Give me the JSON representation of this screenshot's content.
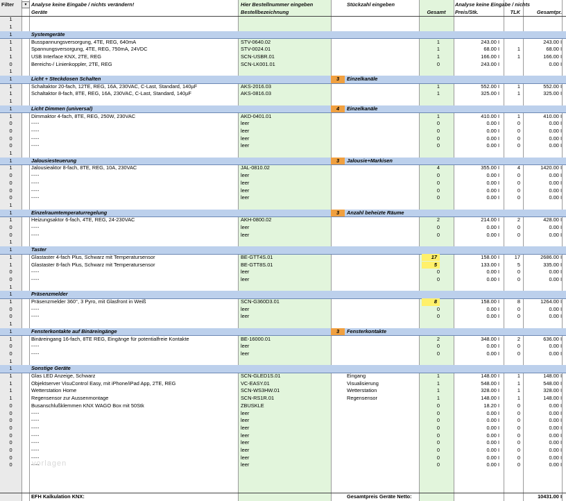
{
  "header": {
    "row1": {
      "filter": "Filter",
      "col_a": "Analyse keine Eingabe / nichts verändern!",
      "col_b": "Hier Bestellnummer eingeben",
      "col_c": "Stückzahl eingeben",
      "col_e": "Analyse keine Eingabe / nichts",
      "col_h": ""
    },
    "row2": {
      "col_a": "Geräte",
      "col_b": "Bestellbezeichnung",
      "col_d": "Gesamt",
      "col_e": "Preis/Stk.",
      "col_g": "TLK",
      "col_h": "Gesamtpr."
    }
  },
  "sections": [
    {
      "title": "Systemgeräte",
      "note_num": "",
      "note_label": "",
      "rows": [
        {
          "f": "1",
          "a": "Busspannungsversorgung, 4TE, REG, 640mA",
          "b": "STV-0640.02",
          "c": "",
          "d": "1",
          "e": "243.00 I",
          "g": "",
          "h": "243.00 I"
        },
        {
          "f": "1",
          "a": "Spannungsversorgung, 4TE, REG, 750mA, 24VDC",
          "b": "STV-0024.01",
          "c": "",
          "d": "1",
          "e": "68.00 I",
          "g": "1",
          "h": "68.00 I"
        },
        {
          "f": "1",
          "a": "USB Interface KNX, 2TE, REG",
          "b": "SCN-USBR.01",
          "c": "",
          "d": "1",
          "e": "166.00 I",
          "g": "1",
          "h": "166.00 I"
        },
        {
          "f": "0",
          "a": "Bereichs-/ Linienkoppler, 2TE, REG",
          "b": "SCN-LK001.01",
          "c": "",
          "d": "0",
          "e": "243.00 I",
          "g": "",
          "h": "0.00 I"
        }
      ]
    },
    {
      "title": "Licht + Steckdosen Schalten",
      "note_num": "3",
      "note_label": "Einzelkanäle",
      "rows": [
        {
          "f": "1",
          "a": "Schaltaktor 20-fach, 12TE, REG, 16A, 230VAC, C-Last, Standard, 140µF",
          "b": "AKS-2016.03",
          "c": "",
          "d": "1",
          "e": "552.00 I",
          "g": "1",
          "h": "552.00 I"
        },
        {
          "f": "1",
          "a": "Schaltaktor 8-fach, 8TE, REG, 16A, 230VAC, C-Last, Standard, 140µF",
          "b": "AKS-0816.03",
          "c": "",
          "d": "1",
          "e": "325.00 I",
          "g": "1",
          "h": "325.00 I"
        }
      ]
    },
    {
      "title": "Licht Dimmen (universal)",
      "note_num": "4",
      "note_label": "Einzelkanäle",
      "rows": [
        {
          "f": "1",
          "a": "Dimmaktor 4-fach, 8TE, REG, 250W, 230VAC",
          "b": "AKD-0401.01",
          "c": "",
          "d": "1",
          "e": "410.00 I",
          "g": "1",
          "h": "410.00 I"
        },
        {
          "f": "0",
          "a": "----",
          "b": "leer",
          "c": "",
          "d": "0",
          "e": "0.00 I",
          "g": "0",
          "h": "0.00 I"
        },
        {
          "f": "0",
          "a": "----",
          "b": "leer",
          "c": "",
          "d": "0",
          "e": "0.00 I",
          "g": "0",
          "h": "0.00 I"
        },
        {
          "f": "0",
          "a": "----",
          "b": "leer",
          "c": "",
          "d": "0",
          "e": "0.00 I",
          "g": "0",
          "h": "0.00 I"
        },
        {
          "f": "0",
          "a": "----",
          "b": "leer",
          "c": "",
          "d": "0",
          "e": "0.00 I",
          "g": "0",
          "h": "0.00 I"
        }
      ]
    },
    {
      "title": "Jalousiesteuerung",
      "note_num": "3",
      "note_label": "Jalousie+Markisen",
      "rows": [
        {
          "f": "1",
          "a": "Jalousieaktor 8-fach, 8TE, REG, 10A, 230VAC",
          "b": "JAL-0810.02",
          "c": "",
          "d": "4",
          "e": "355.00 I",
          "g": "4",
          "h": "1420.00 I"
        },
        {
          "f": "0",
          "a": "----",
          "b": "leer",
          "c": "",
          "d": "0",
          "e": "0.00 I",
          "g": "0",
          "h": "0.00 I"
        },
        {
          "f": "0",
          "a": "----",
          "b": "leer",
          "c": "",
          "d": "0",
          "e": "0.00 I",
          "g": "0",
          "h": "0.00 I"
        },
        {
          "f": "0",
          "a": "----",
          "b": "leer",
          "c": "",
          "d": "0",
          "e": "0.00 I",
          "g": "0",
          "h": "0.00 I"
        },
        {
          "f": "0",
          "a": "----",
          "b": "leer",
          "c": "",
          "d": "0",
          "e": "0.00 I",
          "g": "0",
          "h": "0.00 I"
        }
      ]
    },
    {
      "title": "Einzelraumtemperaturregelung",
      "note_num": "3",
      "note_label": "Anzahl beheizte Räume",
      "rows": [
        {
          "f": "1",
          "a": "Heizungsaktor 6-fach, 4TE, REG, 24-230VAC",
          "b": "AKH-0800.02",
          "c": "",
          "d": "2",
          "e": "214.00 I",
          "g": "2",
          "h": "428.00 I"
        },
        {
          "f": "0",
          "a": "----",
          "b": "leer",
          "c": "",
          "d": "0",
          "e": "0.00 I",
          "g": "0",
          "h": "0.00 I"
        },
        {
          "f": "0",
          "a": "----",
          "b": "leer",
          "c": "",
          "d": "0",
          "e": "0.00 I",
          "g": "0",
          "h": "0.00 I"
        }
      ]
    },
    {
      "title": "Taster",
      "note_num": "",
      "note_label": "",
      "rows": [
        {
          "f": "1",
          "a": "Glastaster 4-fach Plus, Schwarz mit Temperatursensor",
          "b": "BE-GTT4S.01",
          "c": "",
          "d": "17",
          "e": "158.00 I",
          "g": "17",
          "h": "2686.00 I",
          "hl": true
        },
        {
          "f": "1",
          "a": "Glastaster 8-fach Plus, Schwarz mit Temperatursensor",
          "b": "BE-GTT8S.01",
          "c": "",
          "d": "5",
          "e": "133.00 I",
          "g": "5",
          "h": "335.00 I",
          "hl": true
        },
        {
          "f": "0",
          "a": "----",
          "b": "leer",
          "c": "",
          "d": "0",
          "e": "0.00 I",
          "g": "0",
          "h": "0.00 I"
        },
        {
          "f": "0",
          "a": "----",
          "b": "leer",
          "c": "",
          "d": "0",
          "e": "0.00 I",
          "g": "0",
          "h": "0.00 I"
        }
      ]
    },
    {
      "title": "Präsenzmelder",
      "note_num": "",
      "note_label": "",
      "rows": [
        {
          "f": "1",
          "a": "Präsenzmelder 360°, 3 Pyro, mit Glasfront in Weiß",
          "b": "SCN-G360D3.01",
          "c": "",
          "d": "8",
          "e": "158.00 I",
          "g": "8",
          "h": "1264.00 I",
          "hl": true
        },
        {
          "f": "0",
          "a": "----",
          "b": "leer",
          "c": "",
          "d": "0",
          "e": "0.00 I",
          "g": "0",
          "h": "0.00 I"
        },
        {
          "f": "0",
          "a": "----",
          "b": "leer",
          "c": "",
          "d": "0",
          "e": "0.00 I",
          "g": "0",
          "h": "0.00 I"
        }
      ]
    },
    {
      "title": "Fensterkontakte auf Binäreingänge",
      "note_num": "3",
      "note_label": "Fensterkontakte",
      "rows": [
        {
          "f": "1",
          "a": "Binäreingang 16-fach, 8TE REG, Eingänge für potentialfreie Kontakte",
          "b": "BE-16000.01",
          "c": "",
          "d": "2",
          "e": "348.00 I",
          "g": "2",
          "h": "636.00 I"
        },
        {
          "f": "0",
          "a": "----",
          "b": "leer",
          "c": "",
          "d": "0",
          "e": "0.00 I",
          "g": "0",
          "h": "0.00 I"
        },
        {
          "f": "0",
          "a": "----",
          "b": "leer",
          "c": "",
          "d": "0",
          "e": "0.00 I",
          "g": "0",
          "h": "0.00 I"
        }
      ]
    },
    {
      "title": "Sonstige Geräte",
      "note_num": "",
      "note_label": "",
      "rows": [
        {
          "f": "1",
          "a": "Glas LED Anzeige, Schwarz",
          "b": "SCN-GLED1S.01",
          "c": "Eingang",
          "d": "1",
          "e": "148.00 I",
          "g": "1",
          "h": "148.00 I"
        },
        {
          "f": "1",
          "a": "Objektserver VisuControl Easy, mit iPhone/iPad App, 2TE, REG",
          "b": "VC-EASY.01",
          "c": "Visualisierung",
          "d": "1",
          "e": "548.00 I",
          "g": "1",
          "h": "548.00 I"
        },
        {
          "f": "1",
          "a": "Wetterstation Home",
          "b": "SCN-WS3HW.01",
          "c": "Wetterstation",
          "d": "1",
          "e": "328.00 I",
          "g": "1",
          "h": "328.00 I"
        },
        {
          "f": "1",
          "a": "Regensensor zur Aussenmontage",
          "b": "SCN-RS1R.01",
          "c": "Regensensor",
          "d": "1",
          "e": "148.00 I",
          "g": "1",
          "h": "148.00 I"
        },
        {
          "f": "0",
          "a": "Busanschlußklemmen KNX WAGO Box mit 50Stk",
          "b": "ZBUSKLE",
          "c": "",
          "d": "0",
          "e": "18.20 I",
          "g": "0",
          "h": "0.00 I"
        },
        {
          "f": "0",
          "a": "----",
          "b": "leer",
          "c": "",
          "d": "0",
          "e": "0.00 I",
          "g": "0",
          "h": "0.00 I"
        },
        {
          "f": "0",
          "a": "----",
          "b": "leer",
          "c": "",
          "d": "0",
          "e": "0.00 I",
          "g": "0",
          "h": "0.00 I"
        },
        {
          "f": "0",
          "a": "----",
          "b": "leer",
          "c": "",
          "d": "0",
          "e": "0.00 I",
          "g": "0",
          "h": "0.00 I"
        },
        {
          "f": "0",
          "a": "----",
          "b": "leer",
          "c": "",
          "d": "0",
          "e": "0.00 I",
          "g": "0",
          "h": "0.00 I"
        },
        {
          "f": "0",
          "a": "----",
          "b": "leer",
          "c": "",
          "d": "0",
          "e": "0.00 I",
          "g": "0",
          "h": "0.00 I"
        },
        {
          "f": "0",
          "a": "----",
          "b": "leer",
          "c": "",
          "d": "0",
          "e": "0.00 I",
          "g": "0",
          "h": "0.00 I"
        },
        {
          "f": "0",
          "a": "----",
          "b": "leer",
          "c": "",
          "d": "0",
          "e": "0.00 I",
          "g": "0",
          "h": "0.00 I"
        },
        {
          "f": "0",
          "a": "----",
          "b": "leer",
          "c": "",
          "d": "0",
          "e": "0.00 I",
          "g": "0",
          "h": "0.00 I"
        }
      ]
    }
  ],
  "footer": {
    "label": "EFH Kalkulation KNX:",
    "total_label": "Gesamtpreis Geräte Netto:",
    "total_value": "10431.00 I"
  },
  "watermark": "vorlagen",
  "colors": {
    "section_bg": "#bcd0ec",
    "input_green": "#e2f5dc",
    "highlight_yellow": "#fff06a",
    "note_orange": "#f0a040"
  }
}
